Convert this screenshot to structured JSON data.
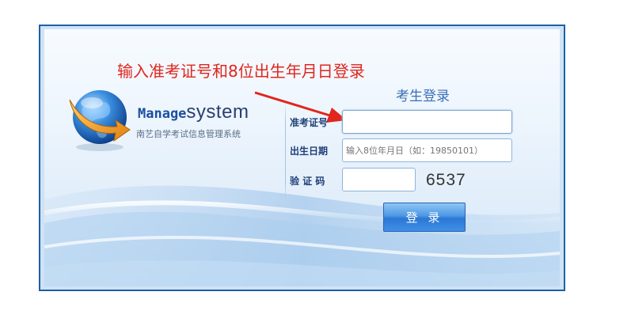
{
  "annotation": {
    "text": "输入准考证号和8位出生年月日登录",
    "color": "#e0261d"
  },
  "logo": {
    "icon": "globe-arrow-icon",
    "word1": "Manage",
    "word2": "system",
    "subtitle": "南艺自学考试信息管理系统"
  },
  "form": {
    "title": "考生登录",
    "exam_no": {
      "label": "准考证号",
      "value": "",
      "placeholder": ""
    },
    "birth_date": {
      "label": "出生日期",
      "value": "",
      "placeholder": "输入8位年月日（如：19850101）"
    },
    "captcha": {
      "label": "验 证 码",
      "value": "",
      "code": "6537"
    },
    "submit_label": "登 录"
  },
  "colors": {
    "frame": "#1f5fa6",
    "button": "#3f8fe6",
    "title": "#3b6fb6",
    "label": "#1e3f78"
  }
}
